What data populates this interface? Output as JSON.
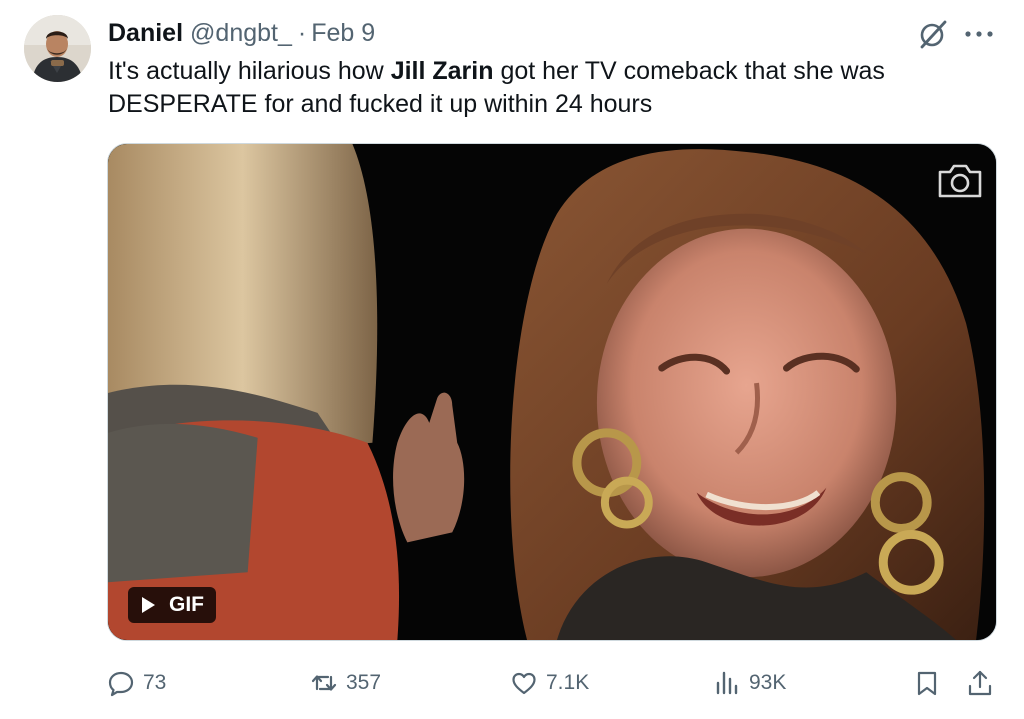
{
  "tweet": {
    "author_name": "Daniel",
    "handle": "@dngbt_",
    "separator": "·",
    "date": "Feb 9",
    "text_before": "It's actually hilarious how ",
    "text_bold": "Jill Zarin",
    "text_after": " got her TV comeback that she was DESPERATE for and fucked it up within 24 hours",
    "media": {
      "badge_label": "GIF"
    },
    "actions": {
      "replies": "73",
      "retweets": "357",
      "likes": "7.1K",
      "views": "93K"
    }
  },
  "icons": {
    "grok": "grok-icon",
    "more": "more-icon",
    "camera": "camera-icon",
    "play": "play-icon",
    "reply": "reply-icon",
    "retweet": "retweet-icon",
    "like": "heart-icon",
    "views": "views-icon",
    "bookmark": "bookmark-icon",
    "share": "share-icon"
  },
  "colors": {
    "text_primary": "#0f1419",
    "text_secondary": "#536471",
    "border": "#cfd9de"
  }
}
